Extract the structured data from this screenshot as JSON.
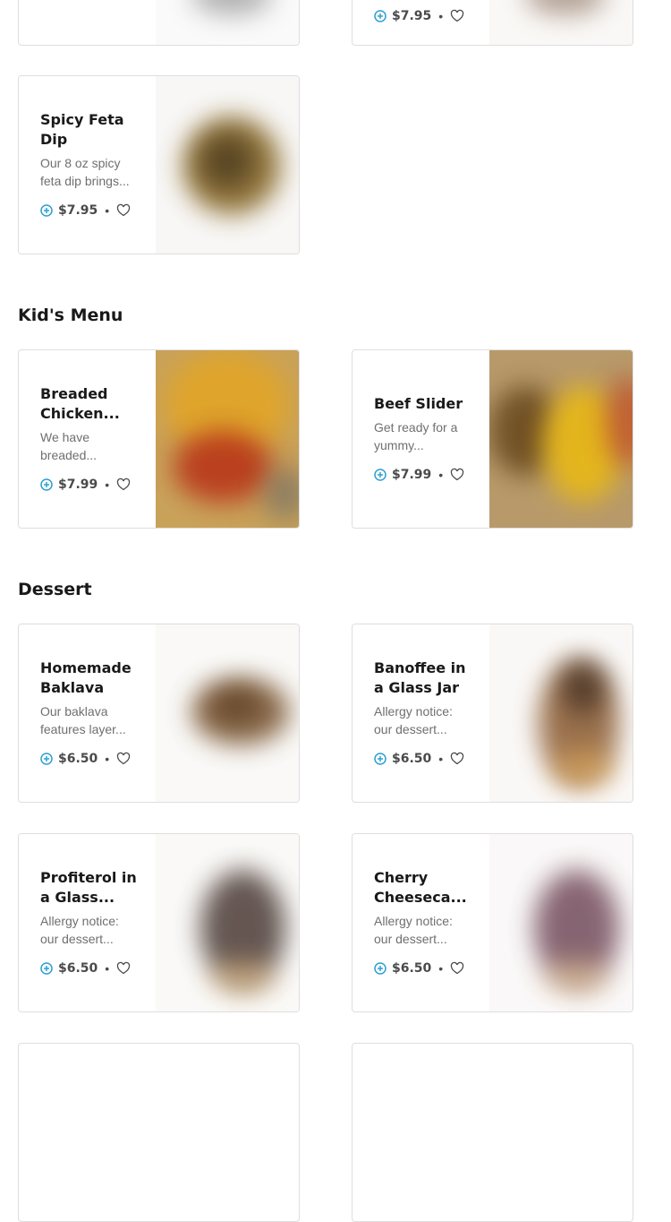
{
  "colors": {
    "accent": "#2e9fd1",
    "price": "#4a4a4a",
    "border": "#dedede"
  },
  "separator": "•",
  "top_cards": [
    {
      "price": "$7.95"
    }
  ],
  "appetizer_cards": [
    {
      "name": "Spicy Feta Dip",
      "desc": "Our 8 oz spicy feta dip brings...",
      "price": "$7.95"
    }
  ],
  "kids_menu": {
    "title": "Kid's Menu",
    "items": [
      {
        "name": "Breaded Chicken...",
        "desc": "We have breaded...",
        "price": "$7.99"
      },
      {
        "name": "Beef Slider",
        "desc": "Get ready for a yummy...",
        "price": "$7.99"
      }
    ]
  },
  "dessert": {
    "title": "Dessert",
    "items": [
      {
        "name": "Homemade Baklava",
        "desc": "Our baklava features layer...",
        "price": "$6.50"
      },
      {
        "name": "Banoffee in a Glass Jar",
        "desc": "Allergy notice: our dessert...",
        "price": "$6.50"
      },
      {
        "name": "Profiterol in a Glass...",
        "desc": "Allergy notice: our dessert...",
        "price": "$6.50"
      },
      {
        "name": "Cherry Cheeseca...",
        "desc": "Allergy notice: our dessert...",
        "price": "$6.50"
      }
    ]
  }
}
